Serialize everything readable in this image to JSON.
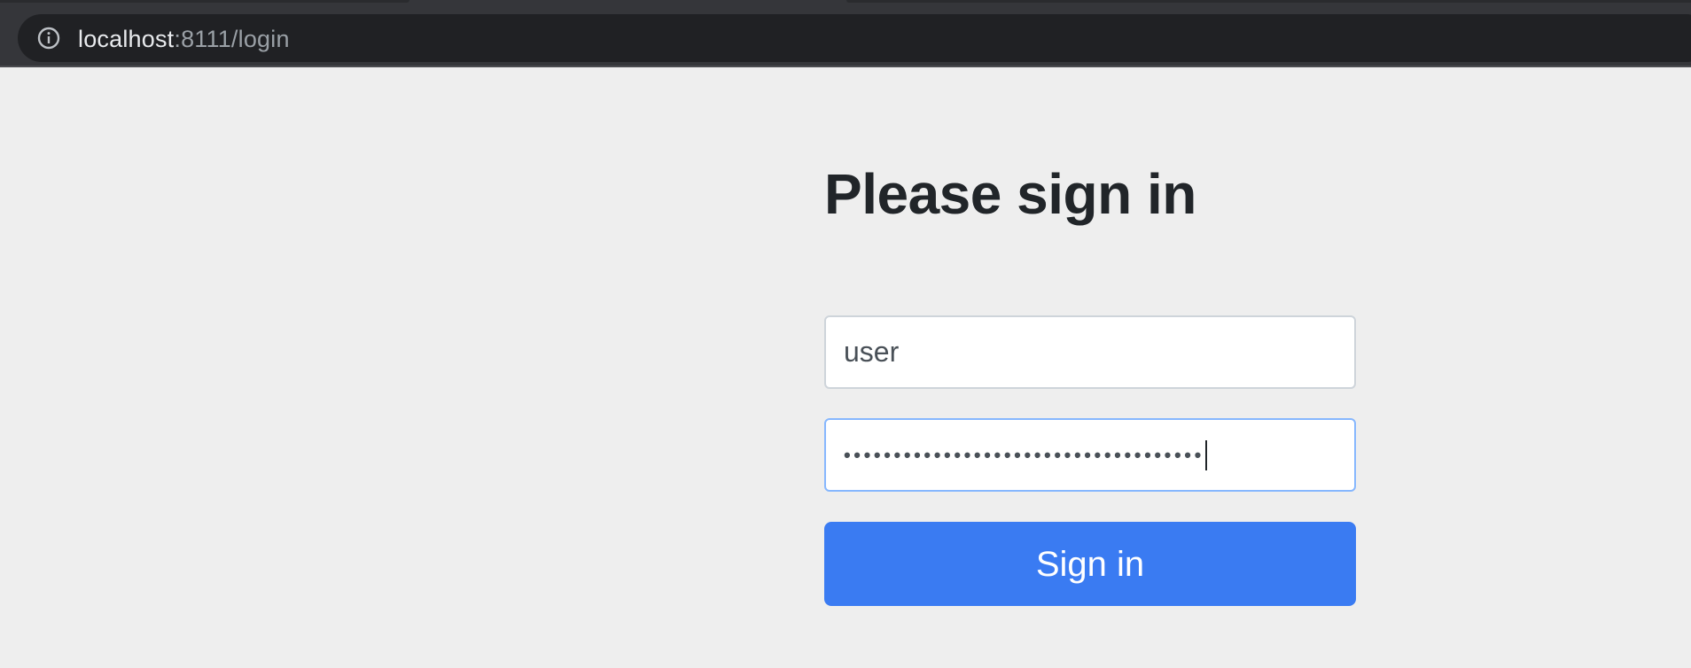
{
  "browser": {
    "url_host": "localhost",
    "url_rest": ":8111/login",
    "icons": {
      "site_info": "info-circle-icon"
    }
  },
  "login": {
    "heading": "Please sign in",
    "username_value": "user",
    "password_masked": "••••••••••••••••••••••••••••••••••••",
    "submit_label": "Sign in"
  },
  "colors": {
    "page_bg": "#eeeeee",
    "primary_button": "#3a7bf2",
    "focus_border": "#86b7fe",
    "toolbar_bg": "#35363a",
    "omnibox_bg": "#202124"
  }
}
